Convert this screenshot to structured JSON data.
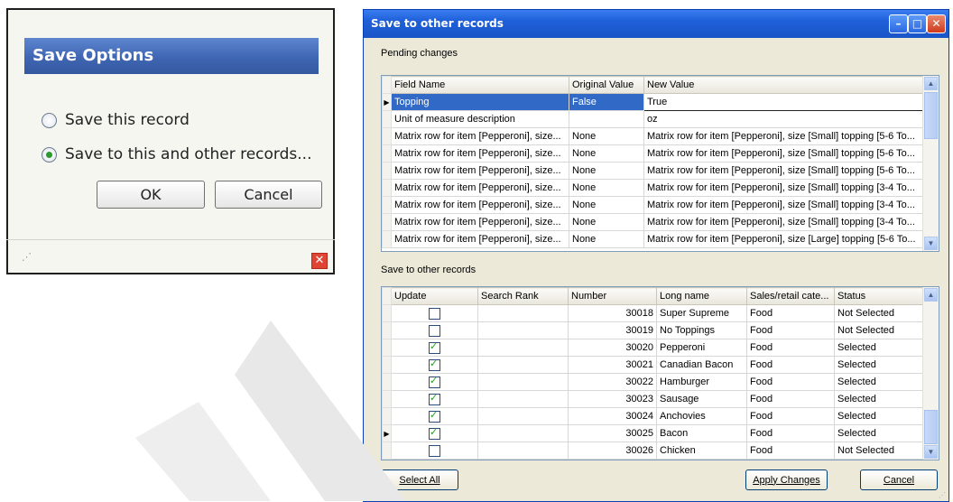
{
  "save_options": {
    "title": "Save Options",
    "options": [
      {
        "label": "Save this record",
        "selected": false
      },
      {
        "label": "Save to this and other records...",
        "selected": true
      }
    ],
    "ok_label": "OK",
    "cancel_label": "Cancel",
    "close_icon": "close-icon"
  },
  "window": {
    "title": "Save to other records",
    "titlebar_buttons": [
      "minimize",
      "maximize",
      "close"
    ],
    "pending_label": "Pending changes",
    "pending_columns": [
      "Field Name",
      "Original Value",
      "New Value"
    ],
    "pending_rows": [
      {
        "field": "Topping",
        "original": "False",
        "new": "True",
        "selected": true
      },
      {
        "field": "Unit of measure description",
        "original": "",
        "new": "oz"
      },
      {
        "field": "Matrix row for item [Pepperoni], size...",
        "original": "None",
        "new": "Matrix row for item [Pepperoni], size [Small] topping [5-6 To..."
      },
      {
        "field": "Matrix row for item [Pepperoni], size...",
        "original": "None",
        "new": "Matrix row for item [Pepperoni], size [Small] topping [5-6 To..."
      },
      {
        "field": "Matrix row for item [Pepperoni], size...",
        "original": "None",
        "new": "Matrix row for item [Pepperoni], size [Small] topping [5-6 To..."
      },
      {
        "field": "Matrix row for item [Pepperoni], size...",
        "original": "None",
        "new": "Matrix row for item [Pepperoni], size [Small] topping [3-4 To..."
      },
      {
        "field": "Matrix row for item [Pepperoni], size...",
        "original": "None",
        "new": "Matrix row for item [Pepperoni], size [Small] topping [3-4 To..."
      },
      {
        "field": "Matrix row for item [Pepperoni], size...",
        "original": "None",
        "new": "Matrix row for item [Pepperoni], size [Small] topping [3-4 To..."
      },
      {
        "field": "Matrix row for item [Pepperoni], size...",
        "original": "None",
        "new": "Matrix row for item [Pepperoni], size [Large] topping [5-6 To..."
      }
    ],
    "records_label": "Save to other records",
    "record_columns": [
      "Update",
      "Search Rank",
      "Number",
      "Long name",
      "Sales/retail cate...",
      "Status"
    ],
    "record_rows": [
      {
        "update": false,
        "rank": "",
        "number": "30018",
        "name": "Super Supreme",
        "category": "Food",
        "status": "Not Selected"
      },
      {
        "update": false,
        "rank": "",
        "number": "30019",
        "name": "No Toppings",
        "category": "Food",
        "status": "Not Selected"
      },
      {
        "update": true,
        "rank": "",
        "number": "30020",
        "name": "Pepperoni",
        "category": "Food",
        "status": "Selected"
      },
      {
        "update": true,
        "rank": "",
        "number": "30021",
        "name": "Canadian Bacon",
        "category": "Food",
        "status": "Selected"
      },
      {
        "update": true,
        "rank": "",
        "number": "30022",
        "name": "Hamburger",
        "category": "Food",
        "status": "Selected"
      },
      {
        "update": true,
        "rank": "",
        "number": "30023",
        "name": "Sausage",
        "category": "Food",
        "status": "Selected"
      },
      {
        "update": true,
        "rank": "",
        "number": "30024",
        "name": "Anchovies",
        "category": "Food",
        "status": "Selected"
      },
      {
        "update": true,
        "rank": "",
        "number": "30025",
        "name": "Bacon",
        "category": "Food",
        "status": "Selected",
        "current": true
      },
      {
        "update": false,
        "rank": "",
        "number": "30026",
        "name": "Chicken",
        "category": "Food",
        "status": "Not Selected"
      }
    ],
    "select_all_label": "Select All",
    "apply_label": "Apply Changes",
    "cancel_label": "Cancel"
  }
}
